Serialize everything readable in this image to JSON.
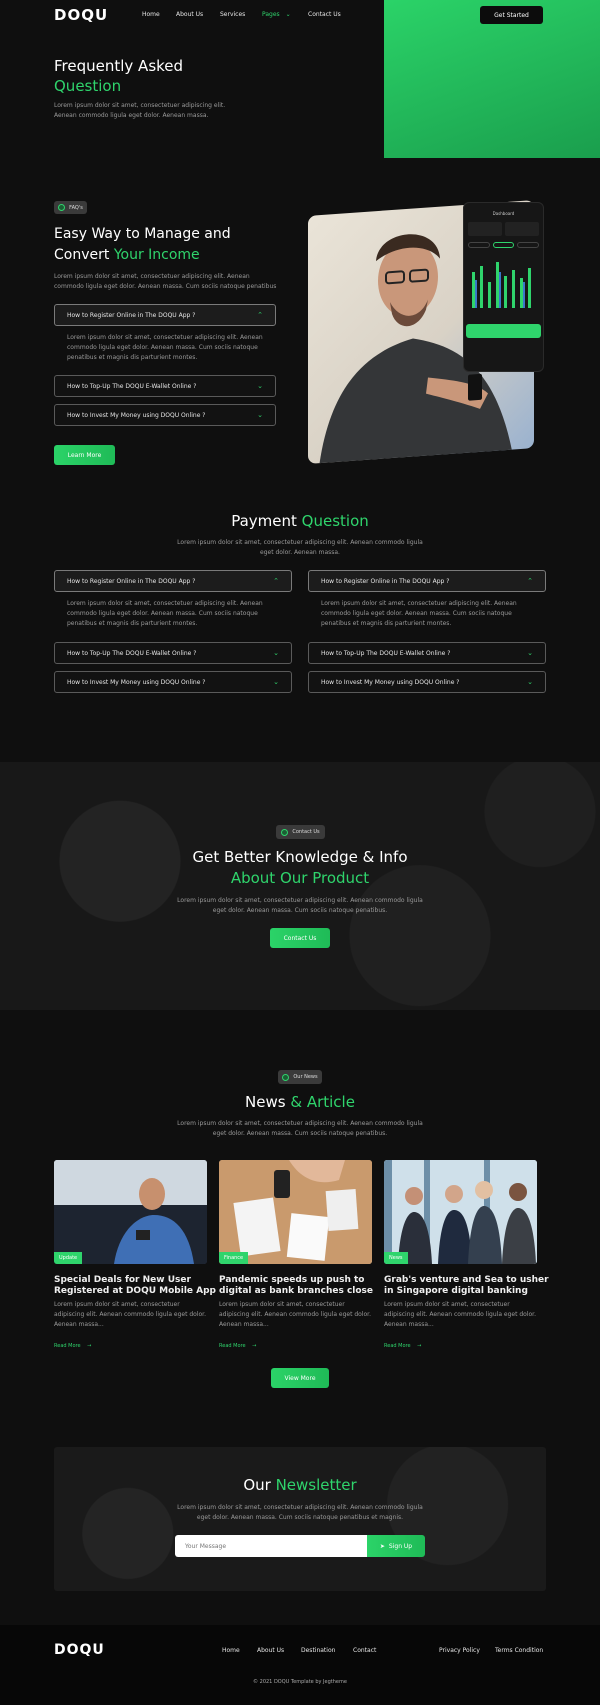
{
  "brand": {
    "logo": "DOQU"
  },
  "nav": {
    "home": "Home",
    "about": "About Us",
    "services": "Services",
    "pages": "Pages",
    "contact": "Contact Us",
    "cta": "Get Started"
  },
  "hero": {
    "title_line1": "Frequently Asked",
    "title_line2": "Question",
    "desc_line1": "Lorem ipsum dolor sit amet, consectetuer adipiscing elit.",
    "desc_line2": "Aenean commodo ligula eget dolor. Aenean massa."
  },
  "faq": {
    "badge": "FAQ's",
    "title_line1": "Easy Way to Manage and",
    "title_line2a": "Convert ",
    "title_line2b": "Your Income",
    "desc_line1": "Lorem ipsum dolor sit amet, consectetuer adipiscing elit. Aenean",
    "desc_line2": "commodo ligula eget dolor. Aenean massa. Cum sociis natoque penatibus",
    "items": [
      {
        "q": "How to Register Online in The DOQU App ?",
        "a_line1": "Lorem ipsum dolor sit amet, consectetuer adipiscing elit. Aenean",
        "a_line2": "commodo ligula eget dolor. Aenean massa. Cum sociis natoque",
        "a_line3": "penatibus et magnis dis parturient montes."
      },
      {
        "q": "How to Top-Up The DOQU E-Wallet Online ?"
      },
      {
        "q": "How to Invest My Money using DOQU Online ?"
      }
    ],
    "learn_more": "Learn More",
    "dashboard_title": "Dashboard"
  },
  "payment": {
    "title_a": "Payment ",
    "title_b": "Question",
    "desc_line1": "Lorem ipsum dolor sit amet, consectetuer adipiscing elit. Aenean commodo ligula",
    "desc_line2": "eget dolor. Aenean massa.",
    "q1": "How to Register Online in The DOQU App ?",
    "a_line1": "Lorem ipsum dolor sit amet, consectetuer adipiscing elit. Aenean",
    "a_line2": "commodo ligula eget dolor. Aenean massa. Cum sociis natoque",
    "a_line3": "penatibus et magnis dis parturient montes.",
    "q2": "How to Top-Up The DOQU E-Wallet Online ?",
    "q3": "How to Invest My Money using DOQU Online ?"
  },
  "knowledge": {
    "badge": "Contact Us",
    "title_line1": "Get Better Knowledge & Info",
    "title_line2a": "About ",
    "title_line2b": "Our Product",
    "desc_line1": "Lorem ipsum dolor sit amet, consectetuer adipiscing elit. Aenean commodo ligula",
    "desc_line2": "eget dolor. Aenean massa. Cum sociis natoque penatibus.",
    "button": "Contact Us"
  },
  "news": {
    "badge": "Our News",
    "title_a": "News ",
    "title_b": "& Article",
    "desc_line1": "Lorem ipsum dolor sit amet, consectetuer adipiscing elit. Aenean commodo ligula",
    "desc_line2": "eget dolor. Aenean massa. Cum sociis natoque penatibus.",
    "cards": [
      {
        "tag": "Update",
        "title_line1": "Special Deals for New User",
        "title_line2": "Registered at DOQU Mobile App",
        "body_line1": "Lorem ipsum dolor sit amet, consectetuer",
        "body_line2": "adipiscing elit. Aenean commodo ligula eget dolor.",
        "body_line3": "Aenean massa...",
        "read": "Read More"
      },
      {
        "tag": "Finance",
        "title_line1": "Pandemic speeds up push to",
        "title_line2": "digital as bank branches close",
        "body_line1": "Lorem ipsum dolor sit amet, consectetuer",
        "body_line2": "adipiscing elit. Aenean commodo ligula eget dolor.",
        "body_line3": "Aenean massa...",
        "read": "Read More"
      },
      {
        "tag": "News",
        "title_line1": "Grab's venture and Sea to usher",
        "title_line2": "in Singapore digital banking",
        "body_line1": "Lorem ipsum dolor sit amet, consectetuer",
        "body_line2": "adipiscing elit. Aenean commodo ligula eget dolor.",
        "body_line3": "Aenean massa...",
        "read": "Read More"
      }
    ],
    "view_more": "View More"
  },
  "newsletter": {
    "title_a": "Our ",
    "title_b": "Newsletter",
    "desc_line1": "Lorem ipsum dolor sit amet, consectetuer adipiscing elit. Aenean commodo ligula",
    "desc_line2": "eget dolor. Aenean massa. Cum sociis natoque penatibus et magnis.",
    "placeholder": "Your Message",
    "button": "Sign Up"
  },
  "footer": {
    "logo": "DOQU",
    "home": "Home",
    "about": "About Us",
    "destination": "Destination",
    "contact": "Contact",
    "privacy": "Privacy Policy",
    "terms": "Terms Condition",
    "copyright": "© 2021 DOQU Template by Jegtheme"
  },
  "colors": {
    "accent": "#2fd46c",
    "bg": "#0f0f0f"
  },
  "icons": [
    "chevron-up-icon",
    "chevron-down-icon",
    "arrow-right-icon",
    "send-icon",
    "dot-icon"
  ]
}
